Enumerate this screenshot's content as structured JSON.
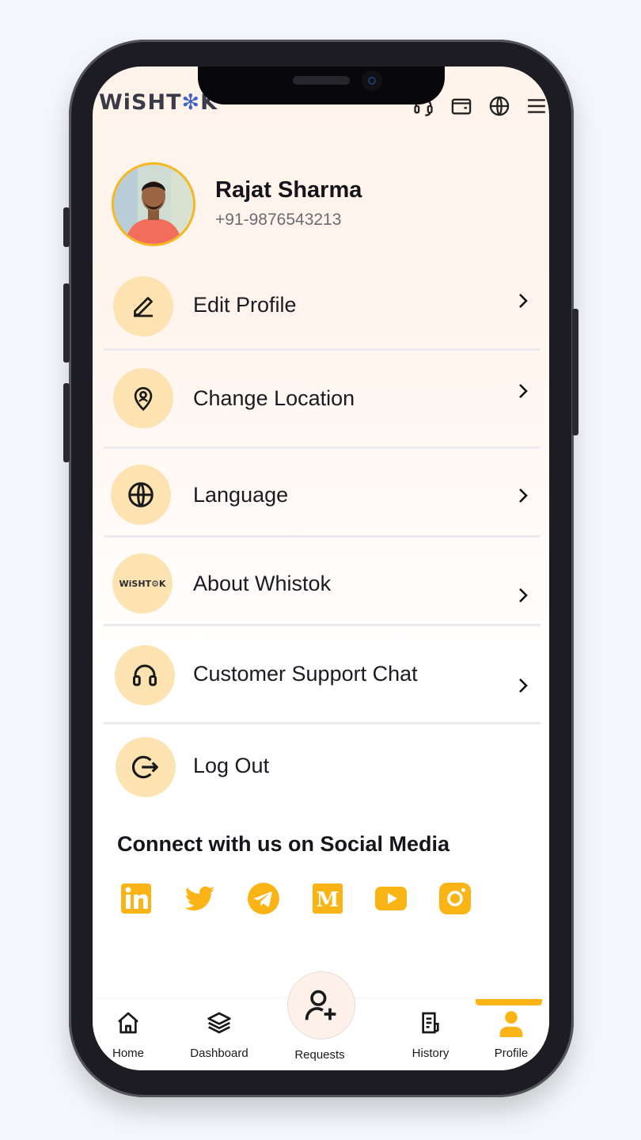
{
  "app": {
    "logo_text_1": "WiSHT",
    "logo_text_2": "K",
    "brand_color": "#fbb415"
  },
  "header_icons": [
    "headset-icon",
    "wallet-icon",
    "globe-icon",
    "menu-icon"
  ],
  "profile": {
    "name": "Rajat Sharma",
    "phone": "+91-9876543213"
  },
  "menu": [
    {
      "label": "Edit Profile",
      "icon": "pencil-icon",
      "chevron": true
    },
    {
      "label": "Change Location",
      "icon": "location-pin-icon",
      "chevron": true
    },
    {
      "label": "Language",
      "icon": "globe-icon",
      "chevron": true
    },
    {
      "label": "About Whistok",
      "icon": "whistok-logo-icon",
      "icon_text": "WiSHT⚙K",
      "chevron": true
    },
    {
      "label": "Customer Support Chat",
      "icon": "headset-icon",
      "chevron": true
    },
    {
      "label": "Log Out",
      "icon": "logout-icon",
      "chevron": false
    }
  ],
  "social": {
    "title": "Connect with us on Social Media",
    "icons": [
      "linkedin-icon",
      "twitter-icon",
      "telegram-icon",
      "medium-icon",
      "youtube-icon",
      "instagram-icon"
    ]
  },
  "tabs": [
    {
      "label": "Home",
      "icon": "home-icon",
      "active": false
    },
    {
      "label": "Dashboard",
      "icon": "layers-icon",
      "active": false
    },
    {
      "label": "Requests",
      "icon": "add-user-icon",
      "active": false
    },
    {
      "label": "History",
      "icon": "receipt-icon",
      "active": false
    },
    {
      "label": "Profile",
      "icon": "user-icon",
      "active": true
    }
  ]
}
